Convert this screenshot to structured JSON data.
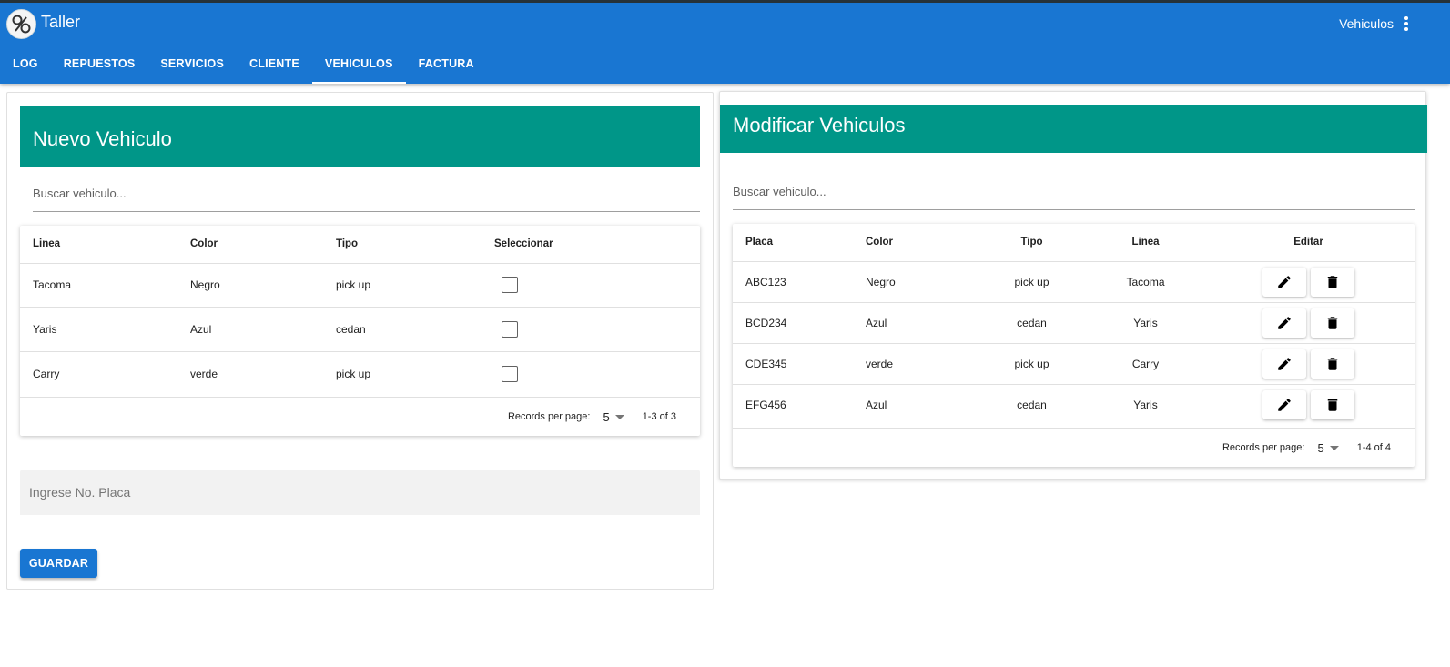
{
  "app": {
    "title": "Taller",
    "user": "Vehiculos"
  },
  "tabs": [
    "LOG",
    "REPUESTOS",
    "SERVICIOS",
    "CLIENTE",
    "VEHICULOS",
    "FACTURA"
  ],
  "active_tab": "VEHICULOS",
  "new_vehicle": {
    "title": "Nuevo Vehiculo",
    "search_placeholder": "Buscar vehiculo...",
    "columns": [
      "Linea",
      "Color",
      "Tipo",
      "Seleccionar"
    ],
    "rows": [
      {
        "linea": "Tacoma",
        "color": "Negro",
        "tipo": "pick up"
      },
      {
        "linea": "Yaris",
        "color": "Azul",
        "tipo": "cedan"
      },
      {
        "linea": "Carry",
        "color": "verde",
        "tipo": "pick up"
      }
    ],
    "records_label": "Records per page:",
    "records_per_page": "5",
    "range": "1-3 of 3",
    "plate_placeholder": "Ingrese No. Placa",
    "save_label": "GUARDAR"
  },
  "modify_vehicle": {
    "title": "Modificar Vehiculos",
    "search_placeholder": "Buscar vehiculo...",
    "columns": [
      "Placa",
      "Color",
      "Tipo",
      "Linea",
      "Editar"
    ],
    "rows": [
      {
        "placa": "ABC123",
        "color": "Negro",
        "tipo": "pick up",
        "linea": "Tacoma"
      },
      {
        "placa": "BCD234",
        "color": "Azul",
        "tipo": "cedan",
        "linea": "Yaris"
      },
      {
        "placa": "CDE345",
        "color": "verde",
        "tipo": "pick up",
        "linea": "Carry"
      },
      {
        "placa": "EFG456",
        "color": "Azul",
        "tipo": "cedan",
        "linea": "Yaris"
      }
    ],
    "records_label": "Records per page:",
    "records_per_page": "5",
    "range": "1-4 of 4"
  },
  "icons": {
    "edit": "pencil-icon",
    "delete": "trash-icon",
    "menu": "more-vert-icon",
    "dropdown": "caret-down-icon"
  },
  "colors": {
    "primary": "#1976d2",
    "header_band": "#009688"
  }
}
